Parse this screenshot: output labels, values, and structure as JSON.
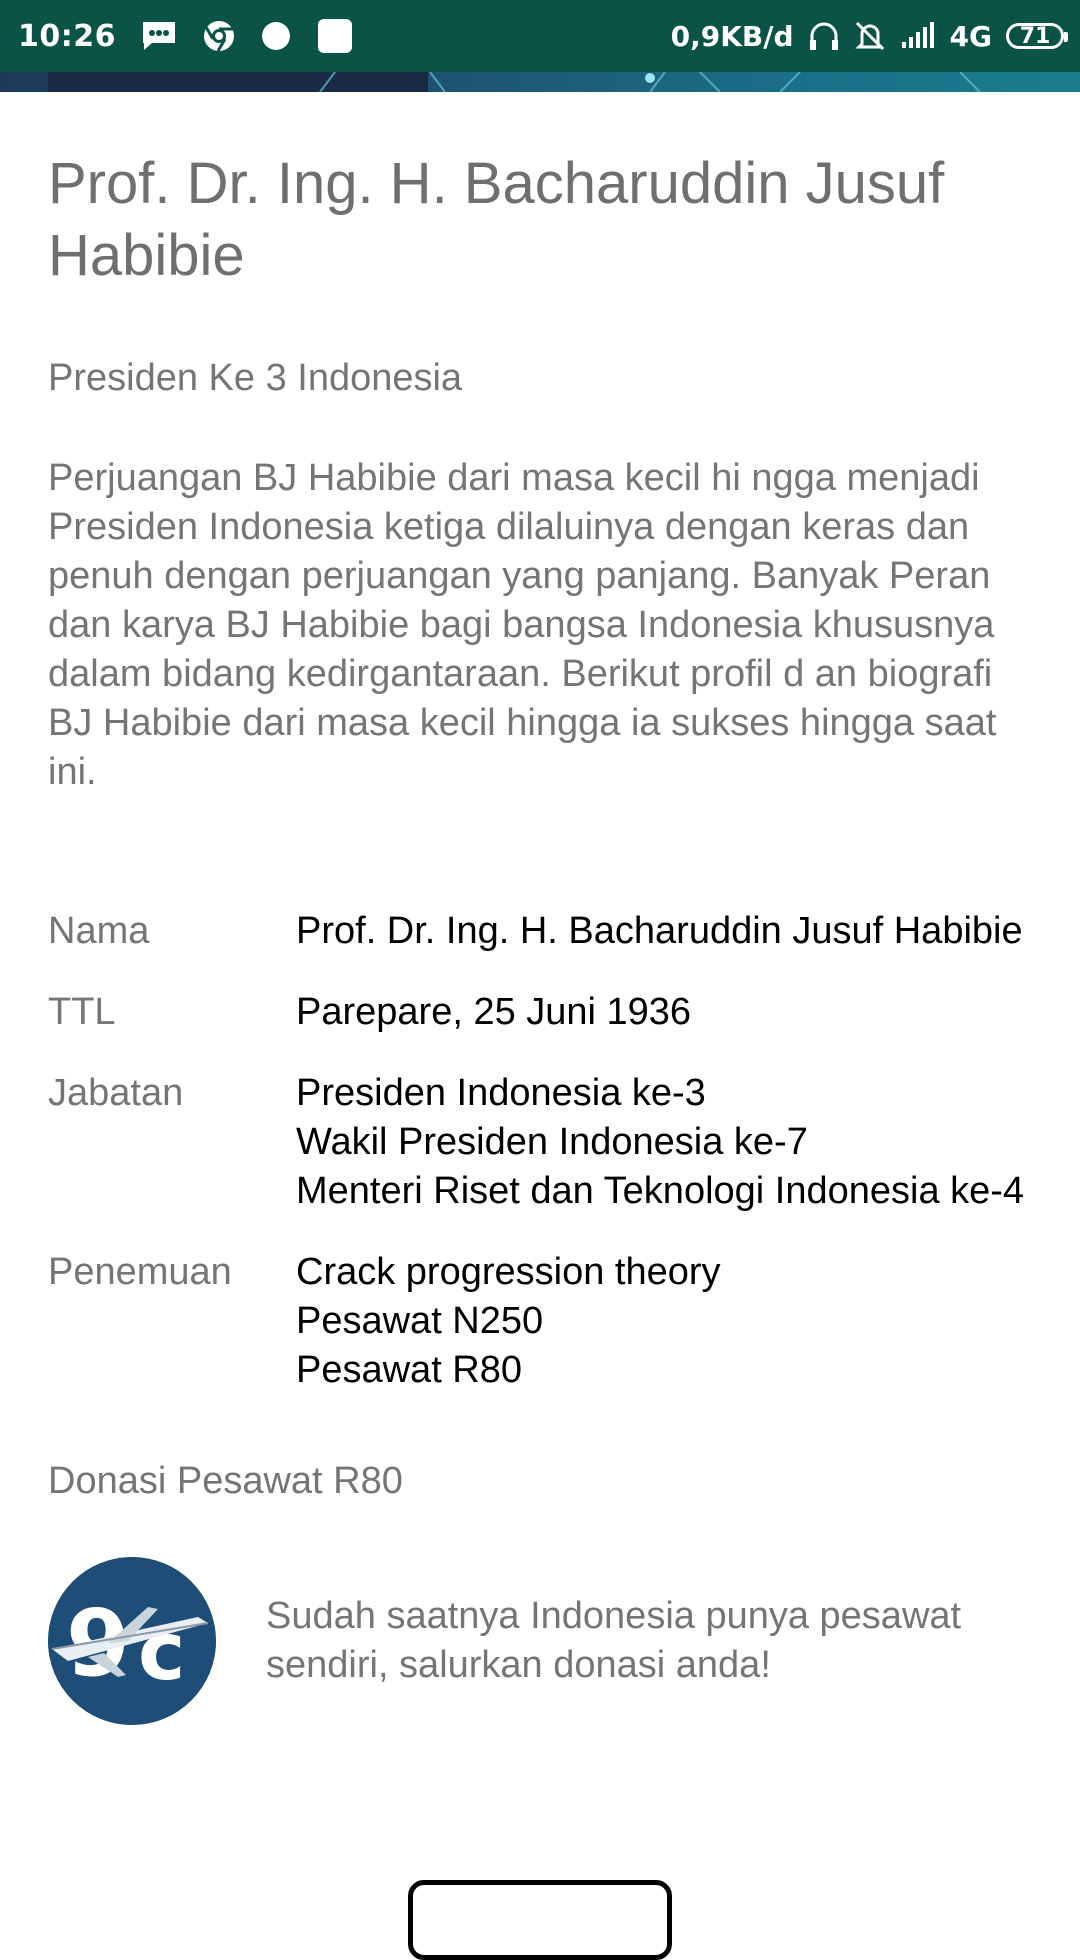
{
  "status_bar": {
    "time": "10:26",
    "network_speed": "0,9KB/d",
    "network_type": "4G",
    "battery": "71",
    "icons": [
      "message-icon",
      "chrome-icon",
      "dot-icon",
      "square-notification-icon",
      "headset-icon",
      "mute-bell-icon",
      "signal-icon",
      "battery-icon"
    ]
  },
  "profile": {
    "title": "Prof. Dr. Ing. H. Bacharuddin Jusuf Habibie",
    "subtitle": "Presiden Ke 3 Indonesia",
    "description": "Perjuangan BJ Habibie dari masa kecil hi ngga menjadi Presiden Indonesia ketiga dilaluinya dengan keras dan penuh dengan perjuangan yang panjang. Banyak Peran dan karya BJ Habibie bagi bangsa Indonesia khususnya dalam bidang kedirgantaraan. Berikut profil d an biografi BJ Habibie dari masa kecil hingga ia sukses hingga saat ini."
  },
  "info": {
    "rows": [
      {
        "label": "Nama",
        "value": "Prof. Dr. Ing. H. Bacharuddin Jusuf Habibie"
      },
      {
        "label": "TTL",
        "value": "Parepare, 25 Juni 1936"
      },
      {
        "label": "Jabatan",
        "value": "Presiden Indonesia ke-3\n Wakil Presiden Indonesia ke-7\n Menteri Riset dan Teknologi Indonesia ke-4"
      },
      {
        "label": "Penemuan",
        "value": "Crack progression theory\n Pesawat N250\n Pesawat R80"
      }
    ]
  },
  "donation": {
    "section_title": "Donasi Pesawat R80",
    "text": "Sudah saatnya Indonesia punya pesawat sendiri, salurkan donasi anda!",
    "logo_icon": "r80-logo-icon"
  },
  "colors": {
    "status_bar_bg": "#0b5247",
    "label_text": "#757575",
    "value_text": "#000000",
    "logo_bg": "#1e4e78"
  }
}
